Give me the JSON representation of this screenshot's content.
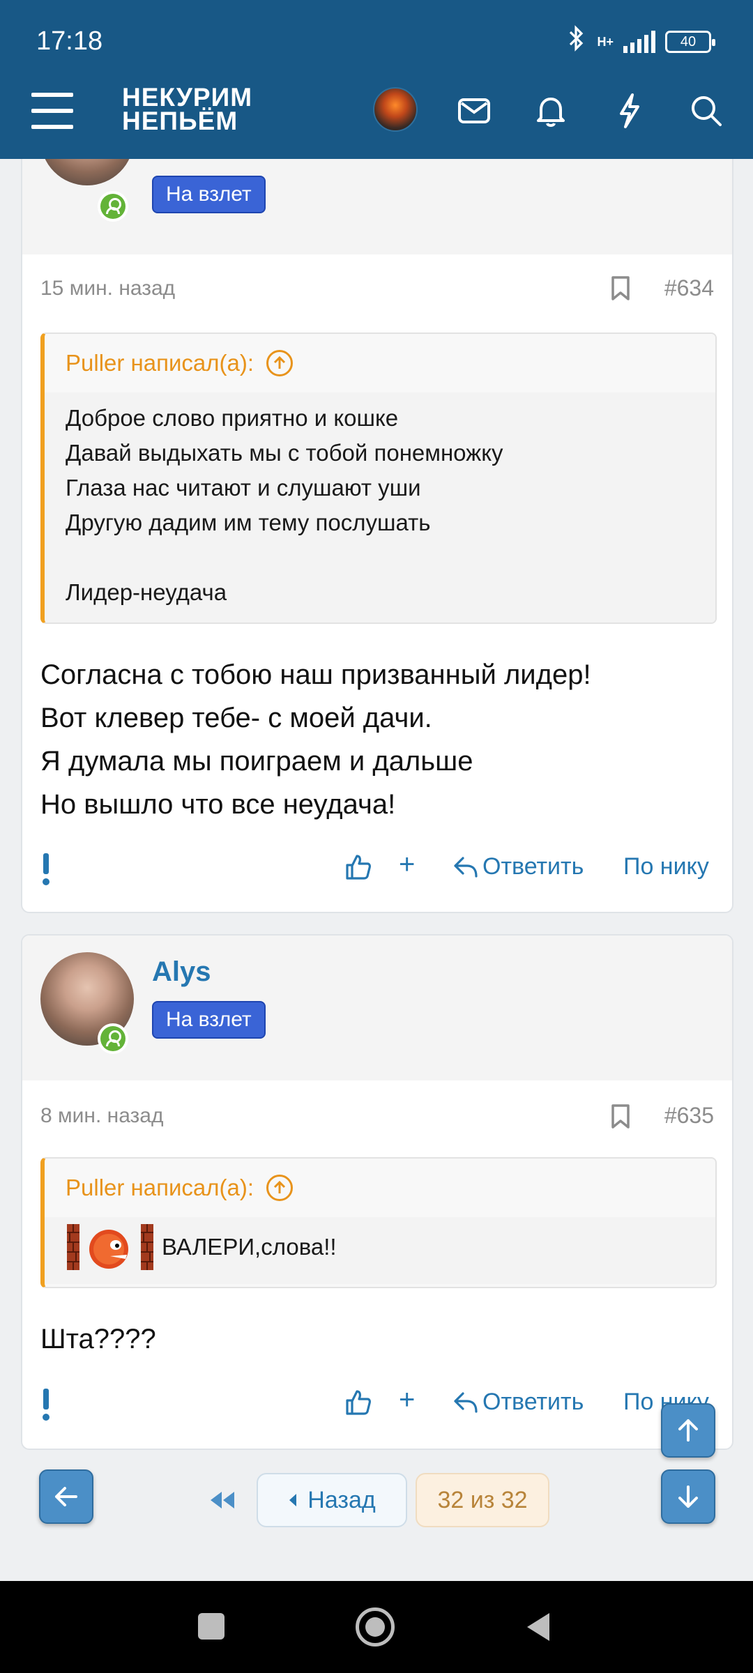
{
  "status_bar": {
    "time": "17:18",
    "network": "H+",
    "battery": "40"
  },
  "header": {
    "logo_line1": "НЕКУРИМ",
    "logo_line2": "НЕПЬЁМ"
  },
  "posts": [
    {
      "badge": "На взлет",
      "time_ago": "15 мин. назад",
      "number": "#634",
      "quote_author": "Puller написал(а):",
      "quote_lines": [
        "Доброе слово приятно и кошке",
        "Давай выдыхать мы с тобой понемножку",
        "Глаза нас читают и слушают уши",
        "Другую дадим им тему послушать",
        "",
        "Лидер-неудача"
      ],
      "message_lines": [
        "Согласна с тобою наш призванный лидер!",
        "Вот клевер тебе- с моей дачи.",
        "Я думала мы поиграем и дальше",
        "Но вышло что все неудача!"
      ]
    },
    {
      "username": "Alys",
      "badge": "На взлет",
      "time_ago": "8 мин. назад",
      "number": "#635",
      "quote_author": "Puller написал(а):",
      "quote_text": "ВАЛЕРИ,слова!!",
      "message_lines": [
        "Шта????"
      ]
    }
  ],
  "actions": {
    "plus": "+",
    "reply": "Ответить",
    "by_nick": "По нику"
  },
  "pagination": {
    "back": "Назад",
    "page": "32 из 32"
  },
  "colors": {
    "header": "#185886",
    "link": "#2577b1",
    "badge": "#3a64d6",
    "quote_accent": "#f0a020"
  }
}
